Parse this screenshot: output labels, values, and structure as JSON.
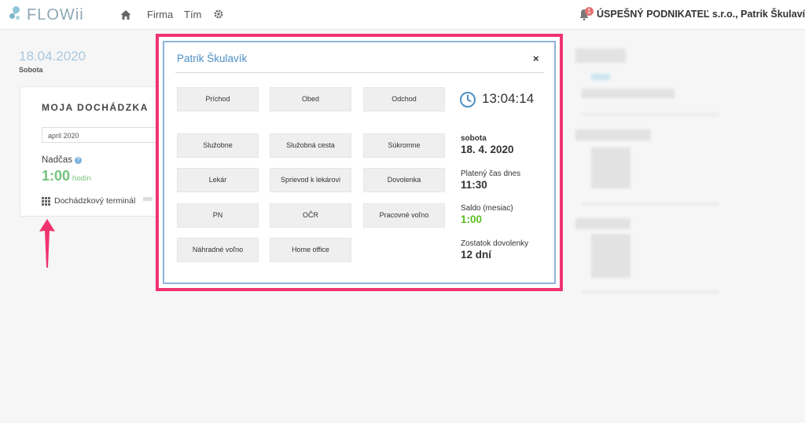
{
  "app": {
    "name": "FLOWii",
    "nav": {
      "firma": "Firma",
      "tim": "Tím"
    },
    "notification_count": "1",
    "company_user": "ÚSPEŠNÝ PODNIKATEĽ s.r.o., Patrik Škulavík"
  },
  "page": {
    "date": "18.04.2020",
    "day": "Sobota",
    "card": {
      "title": "MOJA DOCHÁDZKA",
      "month": "april 2020",
      "nadcas_label": "Nadčas",
      "nadcas_value": "1:00",
      "nadcas_unit": "hodín",
      "terminal_link": "Dochádzkový terminál"
    }
  },
  "modal": {
    "title": "Patrik Škulavík",
    "close": "×",
    "buttons": [
      "Príchod",
      "Obed",
      "Odchod",
      "Služobne",
      "Služobná cesta",
      "Súkromne",
      "Lekár",
      "Sprievod k lekárovi",
      "Dovolenka",
      "PN",
      "OČR",
      "Pracovné voľno",
      "Náhradné voľno",
      "Home office"
    ],
    "time": "13:04:14",
    "day_name": "sobota",
    "date": "18. 4. 2020",
    "paid_time_label": "Platený čas dnes",
    "paid_time_value": "11:30",
    "saldo_label": "Saldo (mesiac)",
    "saldo_value": "1:00",
    "vacation_label": "Zostatok dovolenky",
    "vacation_value": "12 dní"
  },
  "colors": {
    "accent_blue": "#4e8fc3",
    "highlight_pink": "#f0336f",
    "positive_green": "#5bbf21"
  }
}
